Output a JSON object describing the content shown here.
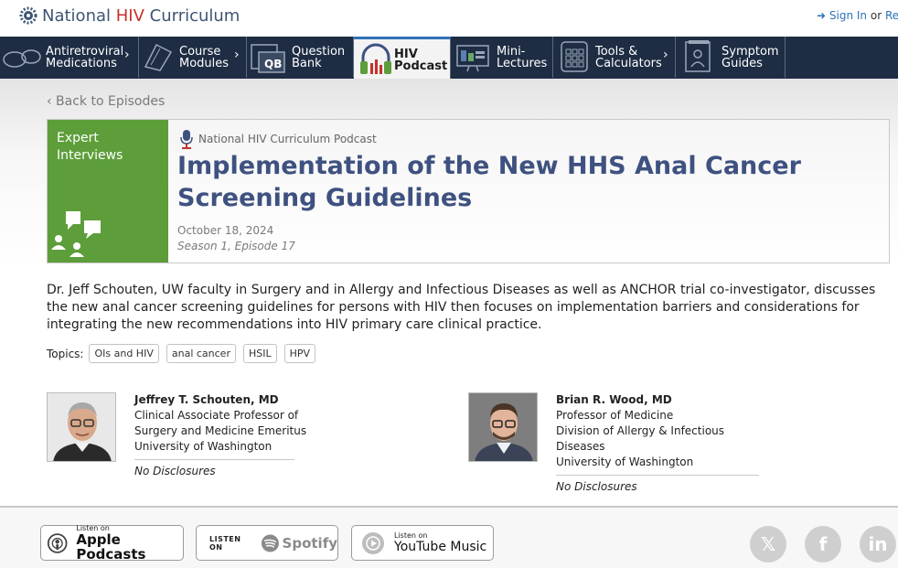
{
  "header": {
    "logo_pre": "National ",
    "logo_hiv": "HIV",
    "logo_post": " Curriculum",
    "sign_in": "Sign In",
    "or": "or",
    "register": "Reg"
  },
  "nav": {
    "items": [
      {
        "line1": "Antiretroviral",
        "line2": "Medications",
        "icon": "pill-icon",
        "has_chevron": true
      },
      {
        "line1": "Course",
        "line2": "Modules",
        "icon": "book-stack-icon",
        "has_chevron": true
      },
      {
        "line1": "Question",
        "line2": "Bank",
        "icon": "question-bank-icon",
        "has_chevron": false
      },
      {
        "line1": "HIV",
        "line2": "Podcast",
        "icon": "headphones-icon",
        "has_chevron": false,
        "active": true
      },
      {
        "line1": "Mini-",
        "line2": "Lectures",
        "icon": "presentation-icon",
        "has_chevron": false
      },
      {
        "line1": "Tools &",
        "line2": "Calculators",
        "icon": "calculator-icon",
        "has_chevron": true
      },
      {
        "line1": "Symptom",
        "line2": "Guides",
        "icon": "guide-book-icon",
        "has_chevron": false
      }
    ]
  },
  "back_link": "‹ Back to Episodes",
  "episode": {
    "category": "Expert Interviews",
    "podcast_name": "National HIV Curriculum Podcast",
    "title": "Implementation of the New HHS Anal Cancer Screening Guidelines",
    "date": "October 18, 2024",
    "season_episode": "Season 1, Episode 17",
    "description": "Dr. Jeff Schouten, UW faculty in Surgery and in Allergy and Infectious Diseases as well as ANCHOR trial co-investigator, discusses the new anal cancer screening guidelines for persons with HIV then focuses on implementation barriers and considerations for integrating the new recommendations into HIV primary care clinical practice.",
    "topics_label": "Topics:",
    "topics": [
      "OIs and HIV",
      "anal cancer",
      "HSIL",
      "HPV"
    ]
  },
  "people": [
    {
      "name": "Jeffrey T. Schouten, MD",
      "line1": "Clinical Associate Professor of",
      "line2": "Surgery and Medicine Emeritus",
      "line3": "University of Washington",
      "disclosure": "No Disclosures"
    },
    {
      "name": "Brian R. Wood, MD",
      "line1": "Professor of Medicine",
      "line2": "Division of Allergy & Infectious Diseases",
      "line3": "University of Washington",
      "disclosure": "No Disclosures"
    }
  ],
  "footer": {
    "apple_small": "Listen on",
    "apple_big": "Apple Podcasts",
    "spotify_small": "LISTEN ON",
    "spotify_big": "Spotify",
    "youtube_small": "Listen on",
    "youtube_big": "YouTube Music",
    "social": [
      "x-icon",
      "facebook-icon",
      "linkedin-icon"
    ]
  },
  "colors": {
    "nav_bg": "#1e2d44",
    "title": "#3e5180",
    "category_tile": "#5d9e3a",
    "logo_red": "#c4312b",
    "link": "#2e72b8"
  }
}
